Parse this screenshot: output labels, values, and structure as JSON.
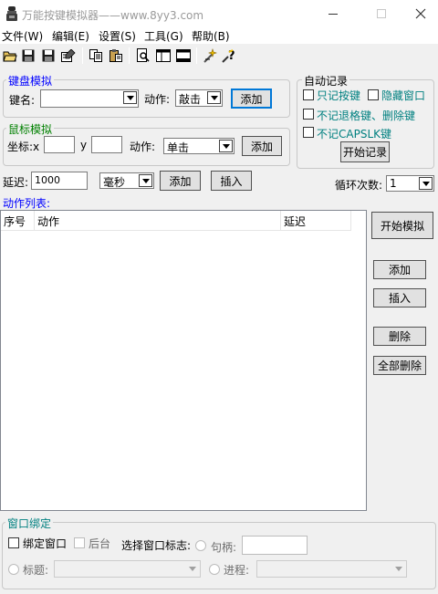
{
  "window": {
    "title": "万能按键模拟器——www.8yy3.com"
  },
  "menu": [
    "文件(W)",
    "编辑(E)",
    "设置(S)",
    "工具(G)",
    "帮助(B)"
  ],
  "keyboard": {
    "legend": "键盘模拟",
    "key_label": "键名:",
    "key_value": "",
    "action_label": "动作:",
    "action_value": "敲击",
    "add_label": "添加"
  },
  "mouse": {
    "legend": "鼠标模拟",
    "coord_label": "坐标:x",
    "x_value": "",
    "y_label": "y",
    "y_value": "",
    "action_label": "动作:",
    "action_value": "单击",
    "add_label": "添加"
  },
  "autorecord": {
    "legend": "自动记录",
    "only_keys": "只记按键",
    "hide_window": "隐藏窗口",
    "no_backspace": "不记退格键、删除键",
    "no_capslock": "不记CAPSLK键",
    "start_label": "开始记录"
  },
  "delay": {
    "label": "延迟:",
    "value": "1000",
    "unit": "毫秒",
    "add_label": "添加",
    "insert_label": "插入"
  },
  "loop": {
    "label": "循环次数:",
    "value": "1"
  },
  "action_list": {
    "title": "动作列表:",
    "columns": [
      "序号",
      "动作",
      "延迟"
    ]
  },
  "side_buttons": {
    "start_sim": "开始模拟",
    "add": "添加",
    "insert": "插入",
    "delete": "删除",
    "delete_all": "全部删除"
  },
  "bind": {
    "legend": "窗口绑定",
    "bind_window": "绑定窗口",
    "background": "后台",
    "select_flag": "选择窗口标志:",
    "handle": "句柄:",
    "handle_value": "",
    "title_label": "标题:",
    "process_label": "进程:"
  }
}
